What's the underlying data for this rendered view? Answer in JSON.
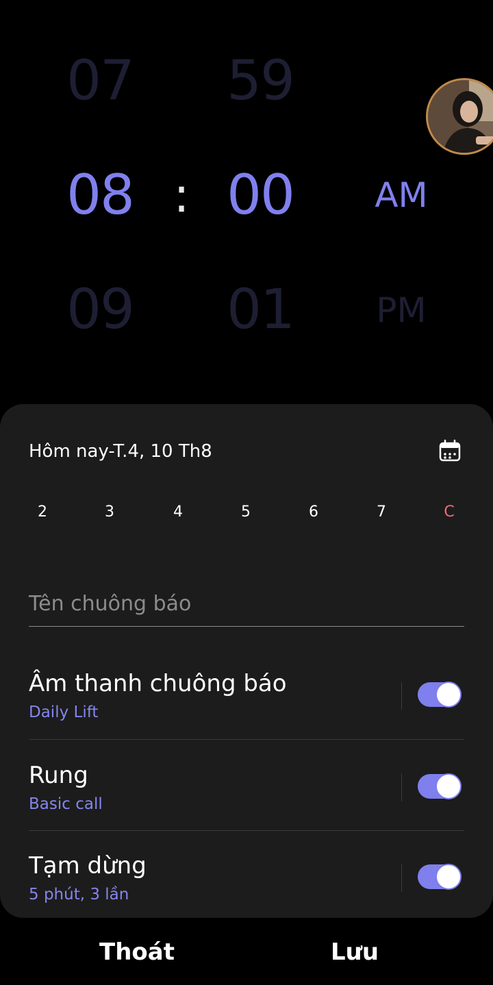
{
  "time_picker": {
    "hour_prev": "07",
    "hour_selected": "08",
    "hour_next": "09",
    "separator": ":",
    "minute_prev": "59",
    "minute_selected": "00",
    "minute_next": "01",
    "period_selected": "AM",
    "period_next": "PM"
  },
  "schedule": {
    "date_label": "Hôm nay-T.4, 10 Th8",
    "calendar_icon": "calendar-icon",
    "days": [
      "2",
      "3",
      "4",
      "5",
      "6",
      "7",
      "C"
    ]
  },
  "alarm_name": {
    "placeholder": "Tên chuông báo"
  },
  "settings": [
    {
      "title": "Âm thanh chuông báo",
      "subtitle": "Daily Lift",
      "enabled": true
    },
    {
      "title": "Rung",
      "subtitle": "Basic call",
      "enabled": true
    },
    {
      "title": "Tạm dừng",
      "subtitle": "5 phút, 3 lần",
      "enabled": true
    }
  ],
  "actions": {
    "cancel_label": "Thoát",
    "save_label": "Lưu"
  },
  "colors": {
    "accent": "#8080ee",
    "sunday": "#f06b7c",
    "sheet_background": "#1c1c1c"
  }
}
